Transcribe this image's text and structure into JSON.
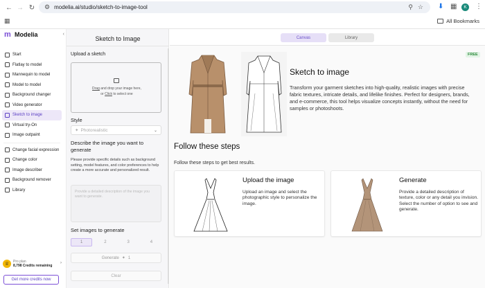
{
  "browser": {
    "url": "modelia.ai/studio/sketch-to-image-tool",
    "avatar_letter": "K",
    "all_bookmarks": "All Bookmarks"
  },
  "sidebar": {
    "brand": "Modelia",
    "items": [
      {
        "label": "Start"
      },
      {
        "label": "Flatlay to model"
      },
      {
        "label": "Mannequin to model"
      },
      {
        "label": "Model to model"
      },
      {
        "label": "Background changer"
      },
      {
        "label": "Video generator"
      },
      {
        "label": "Sketch to image",
        "active": true
      },
      {
        "label": "Virtual try-On"
      },
      {
        "label": "Image outpaint"
      }
    ],
    "items2": [
      {
        "label": "Change facial expression"
      },
      {
        "label": "Change color"
      },
      {
        "label": "Image describer"
      },
      {
        "label": "Background remover"
      },
      {
        "label": "Library"
      }
    ],
    "plan": {
      "name": "Pro plan",
      "credits": "8,798 Credits remaining"
    },
    "cta": "Get more credits now"
  },
  "panel": {
    "title": "Sketch to Image",
    "upload_label": "Upload a sketch",
    "upload_drag": "Drag",
    "upload_text1_rest": " and drop your image here,",
    "upload_or": "or ",
    "upload_click": "Click",
    "upload_text2_rest": " to select one",
    "style_label": "Style",
    "style_value": "Photorealistic",
    "describe_heading": "Describe the image you want to generate",
    "describe_help": "Please provide specific details such as background setting, model features, and color preferences to help create a more accurate and personalized result.",
    "describe_placeholder": "Provide a detailed description of the image you want to generate.",
    "set_images_heading": "Set images to generate",
    "counts": [
      "1",
      "2",
      "3",
      "4"
    ],
    "generate_label": "Generate",
    "generate_cost": "1",
    "clear_label": "Clear"
  },
  "main": {
    "tabs": {
      "canvas": "Canvas",
      "library": "Library"
    },
    "badge": "FREE",
    "hero_title": "Sketch to image",
    "hero_desc": "Transform your garment sketches into high-quality, realistic images with precise fabric textures, intricate details, and lifelike finishes. Perfect for designers, brands, and e-commerce, this tool helps visualize concepts instantly, without the need for samples or photoshoots.",
    "steps_title": "Follow these steps",
    "steps_subtitle": "Follow these steps to get best results.",
    "step1": {
      "title": "Upload the image",
      "text": "Upload an image and select the photographic style to personalize the image."
    },
    "step2": {
      "title": "Generate",
      "text": "Provide a detailed description of texture, color or any detail you invision. Select the number of option to see and generate."
    }
  },
  "colors": {
    "accent": "#7b4fd6",
    "active_bg": "#ede7f8",
    "free_green": "#2e8b3e",
    "trench_tan": "#b8906b"
  }
}
